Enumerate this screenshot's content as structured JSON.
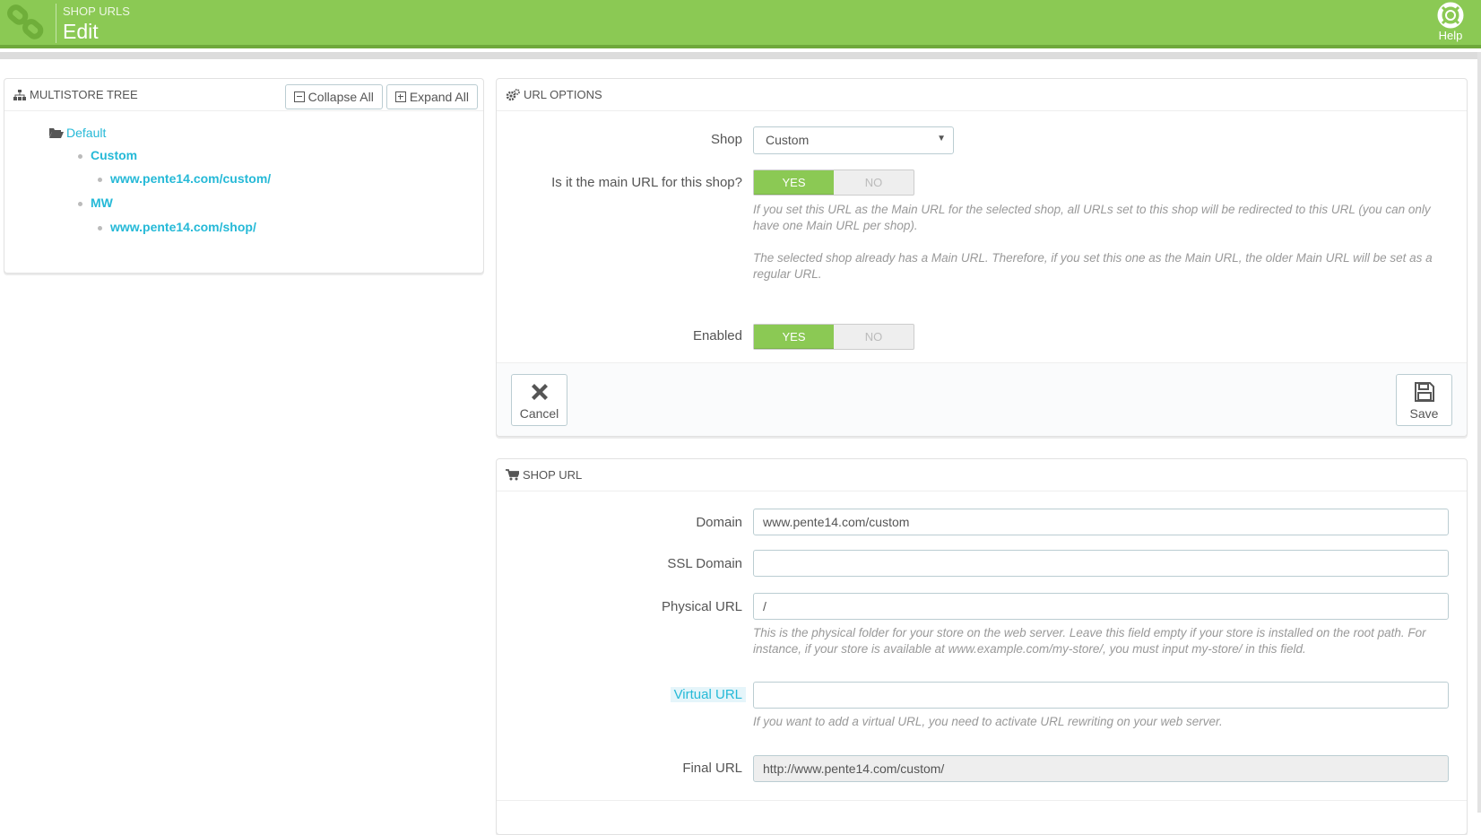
{
  "header": {
    "breadcrumb": "SHOP URLS",
    "title": "Edit",
    "help_label": "Help",
    "accent_color": "#8bc954"
  },
  "tree": {
    "heading": "MULTISTORE TREE",
    "collapse_label": "Collapse All",
    "expand_label": "Expand All",
    "nodes": {
      "default": "Default",
      "custom": "Custom",
      "custom_url": "www.pente14.com/custom/",
      "mw": "MW",
      "mw_url": "www.pente14.com/shop/"
    }
  },
  "options": {
    "heading": "URL OPTIONS",
    "shop_label": "Shop",
    "shop_value": "Custom",
    "main_url_label": "Is it the main URL for this shop?",
    "yes": "YES",
    "no": "NO",
    "main_url_help1": "If you set this URL as the Main URL for the selected shop, all URLs set to this shop will be redirected to this URL (you can only have one Main URL per shop).",
    "main_url_help2": "The selected shop already has a Main URL. Therefore, if you set this one as the Main URL, the older Main URL will be set as a regular URL.",
    "enabled_label": "Enabled",
    "cancel_label": "Cancel",
    "save_label": "Save"
  },
  "shop_url": {
    "heading": "SHOP URL",
    "domain_label": "Domain",
    "domain_value": "www.pente14.com/custom",
    "ssl_label": "SSL Domain",
    "ssl_value": "",
    "physical_label": "Physical URL",
    "physical_value": "/",
    "physical_help": "This is the physical folder for your store on the web server. Leave this field empty if your store is installed on the root path. For instance, if your store is available at www.example.com/my-store/, you must input my-store/ in this field.",
    "virtual_label": "Virtual URL",
    "virtual_value": "",
    "virtual_help": "If you want to add a virtual URL, you need to activate URL rewriting on your web server.",
    "final_label": "Final URL",
    "final_value": "http://www.pente14.com/custom/"
  }
}
